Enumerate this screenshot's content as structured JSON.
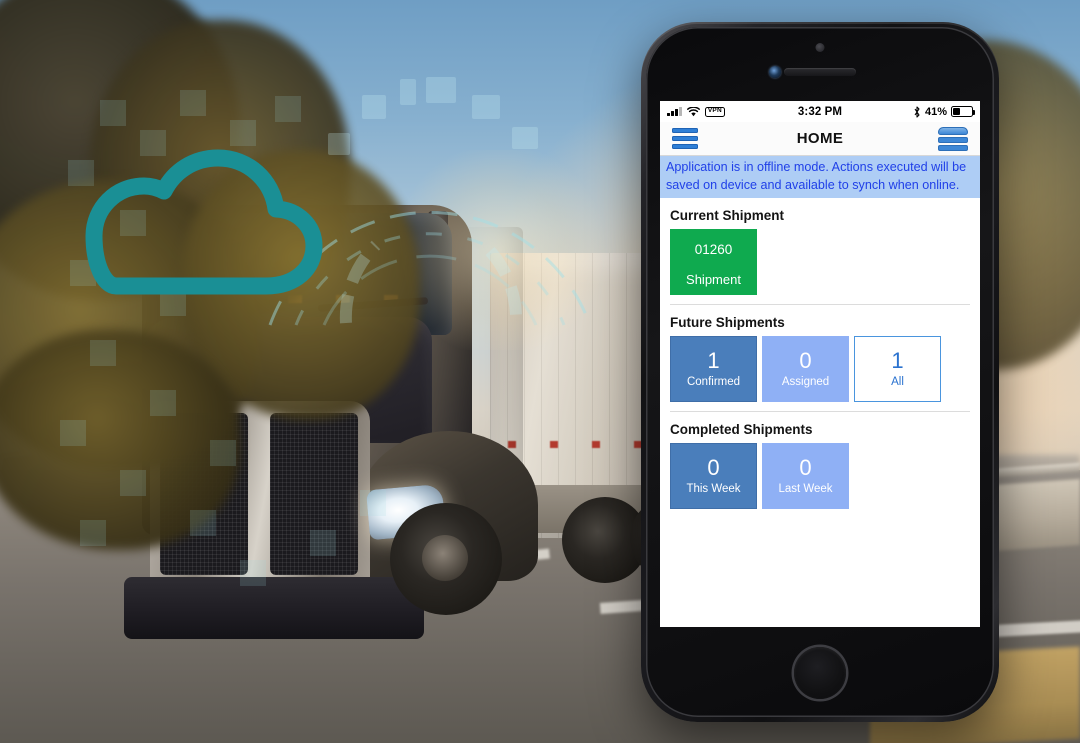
{
  "background": {
    "scene_description": "semi-truck on highway at sunset",
    "logo_icon": "cloud-icon",
    "logo_color": "#1a8f95",
    "accent_arc_color": "#7fd3dd"
  },
  "phone": {
    "device": "iphone",
    "home_button": "home-button"
  },
  "status_bar": {
    "signal_icon": "cellular-signal-icon",
    "wifi_icon": "wifi-icon",
    "vpn_label": "VPN",
    "time": "3:32 PM",
    "bluetooth_icon": "bluetooth-icon",
    "battery_percent": "41%",
    "battery_icon": "battery-icon",
    "battery_level": 41
  },
  "nav_bar": {
    "menu_icon": "hamburger-menu-icon",
    "title": "HOME",
    "database_icon": "database-sync-icon"
  },
  "banner": {
    "text": "Application is in offline mode. Actions executed will be saved on device and available to synch when online.",
    "background_color": "#aecdf5",
    "text_color": "#2040e8"
  },
  "sections": [
    {
      "title": "Current Shipment",
      "tiles": [
        {
          "value": "01260",
          "label": "Shipment",
          "style": "green",
          "color": "#0faa4f"
        }
      ]
    },
    {
      "title": "Future Shipments",
      "tiles": [
        {
          "value": "1",
          "label": "Confirmed",
          "style": "dark",
          "color": "#4a7ebb"
        },
        {
          "value": "0",
          "label": "Assigned",
          "style": "light",
          "color": "#8fb0f5"
        },
        {
          "value": "1",
          "label": "All",
          "style": "outline",
          "color": "#4a95de"
        }
      ]
    },
    {
      "title": "Completed Shipments",
      "tiles": [
        {
          "value": "0",
          "label": "This Week",
          "style": "dark",
          "color": "#4a7ebb"
        },
        {
          "value": "0",
          "label": "Last Week",
          "style": "light",
          "color": "#8fb0f5"
        }
      ]
    }
  ]
}
